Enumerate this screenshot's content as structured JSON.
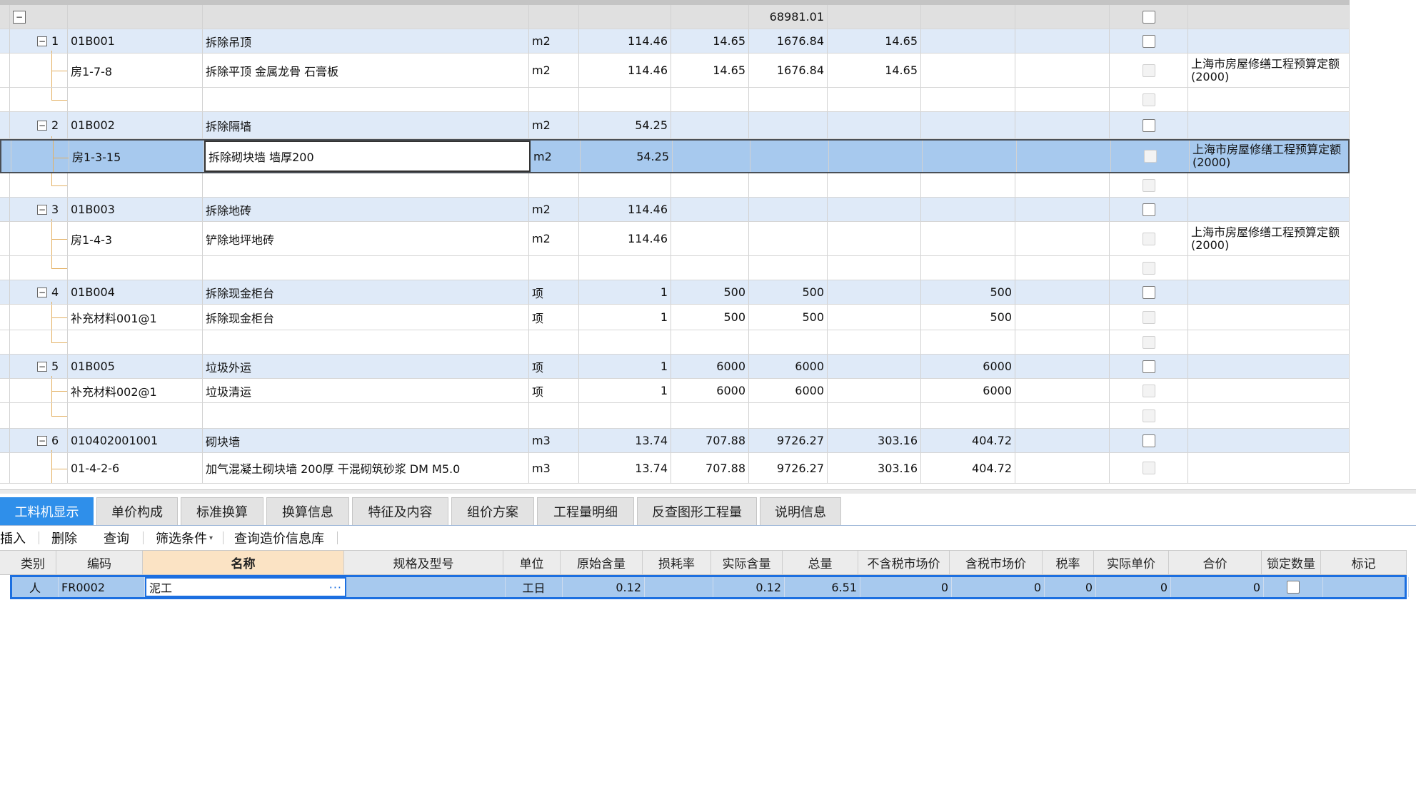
{
  "summary_total": "68981.01",
  "rows": [
    {
      "kind": "list",
      "seq": "1",
      "code": "01B001",
      "name": "拆除吊顶",
      "unit": "m2",
      "qty": "114.46",
      "c6": "14.65",
      "c7": "1676.84",
      "c8": "14.65",
      "c9": "",
      "c10": "",
      "note": ""
    },
    {
      "kind": "quota",
      "seq": "",
      "code": "房1-7-8",
      "name": "拆除平顶 金属龙骨 石膏板",
      "unit": "m2",
      "qty": "114.46",
      "c6": "14.65",
      "c7": "1676.84",
      "c8": "14.65",
      "c9": "",
      "c10": "",
      "note": "上海市房屋修缮工程预算定额(2000)"
    },
    {
      "kind": "blank"
    },
    {
      "kind": "list",
      "seq": "2",
      "code": "01B002",
      "name": "拆除隔墙",
      "unit": "m2",
      "qty": "54.25",
      "c6": "",
      "c7": "",
      "c8": "",
      "c9": "",
      "c10": "",
      "note": ""
    },
    {
      "kind": "quota",
      "selected": true,
      "seq": "",
      "code": "房1-3-15",
      "name": "拆除砌块墙 墙厚200",
      "unit": "m2",
      "qty": "54.25",
      "c6": "",
      "c7": "",
      "c8": "",
      "c9": "",
      "c10": "",
      "note": "上海市房屋修缮工程预算定额(2000)"
    },
    {
      "kind": "blank"
    },
    {
      "kind": "list",
      "seq": "3",
      "code": "01B003",
      "name": "拆除地砖",
      "unit": "m2",
      "qty": "114.46",
      "c6": "",
      "c7": "",
      "c8": "",
      "c9": "",
      "c10": "",
      "note": ""
    },
    {
      "kind": "quota",
      "seq": "",
      "code": "房1-4-3",
      "name": "铲除地坪地砖",
      "unit": "m2",
      "qty": "114.46",
      "c6": "",
      "c7": "",
      "c8": "",
      "c9": "",
      "c10": "",
      "note": "上海市房屋修缮工程预算定额(2000)"
    },
    {
      "kind": "blank"
    },
    {
      "kind": "list",
      "seq": "4",
      "code": "01B004",
      "name": "拆除现金柜台",
      "unit": "项",
      "qty": "1",
      "c6": "500",
      "c7": "500",
      "c8": "",
      "c9": "500",
      "c10": "",
      "note": ""
    },
    {
      "kind": "quota",
      "seq": "",
      "code": "补充材料001@1",
      "name": "拆除现金柜台",
      "unit": "项",
      "qty": "1",
      "c6": "500",
      "c7": "500",
      "c8": "",
      "c9": "500",
      "c10": "",
      "note": ""
    },
    {
      "kind": "blank"
    },
    {
      "kind": "list",
      "seq": "5",
      "code": "01B005",
      "name": "垃圾外运",
      "unit": "项",
      "qty": "1",
      "c6": "6000",
      "c7": "6000",
      "c8": "",
      "c9": "6000",
      "c10": "",
      "note": ""
    },
    {
      "kind": "quota",
      "seq": "",
      "code": "补充材料002@1",
      "name": "垃圾清运",
      "unit": "项",
      "qty": "1",
      "c6": "6000",
      "c7": "6000",
      "c8": "",
      "c9": "6000",
      "c10": "",
      "note": ""
    },
    {
      "kind": "blank"
    },
    {
      "kind": "list",
      "seq": "6",
      "code": "010402001001",
      "name": "砌块墙",
      "unit": "m3",
      "qty": "13.74",
      "c6": "707.88",
      "c7": "9726.27",
      "c8": "303.16",
      "c9": "404.72",
      "c10": "",
      "note": ""
    },
    {
      "kind": "quota",
      "seq": "",
      "code": "01-4-2-6",
      "name": "加气混凝土砌块墙 200厚 干混砌筑砂浆 DM M5.0",
      "unit": "m3",
      "qty": "13.74",
      "c6": "707.88",
      "c7": "9726.27",
      "c8": "303.16",
      "c9": "404.72",
      "c10": "",
      "note": ""
    }
  ],
  "tabs": [
    "工料机显示",
    "单价构成",
    "标准换算",
    "换算信息",
    "特征及内容",
    "组价方案",
    "工程量明细",
    "反查图形工程量",
    "说明信息"
  ],
  "active_tab": 0,
  "toolbar": {
    "insert": "插入",
    "delete": "删除",
    "query": "查询",
    "filter": "筛选条件",
    "query_db": "查询造价信息库"
  },
  "sub_headers": [
    "类别",
    "编码",
    "名称",
    "规格及型号",
    "单位",
    "原始含量",
    "损耗率",
    "实际含量",
    "总量",
    "不含税市场价",
    "含税市场价",
    "税率",
    "实际单价",
    "合价",
    "锁定数量",
    "标记"
  ],
  "sub_row": {
    "cat": "人",
    "code": "FR0002",
    "name": "泥工",
    "spec": "",
    "unit": "工日",
    "orig": "0.12",
    "loss": "",
    "actual": "0.12",
    "total": "6.51",
    "price_ex": "0",
    "price_in": "0",
    "tax": "0",
    "unit_price": "0",
    "sum": "0",
    "mark": ""
  },
  "colors": {
    "list_row": "#dfeaf8",
    "selected_row": "#a7c9ee",
    "tab_active": "#2f8fea",
    "tree_line": "#e3b062",
    "sub_border": "#1c6fe0"
  }
}
